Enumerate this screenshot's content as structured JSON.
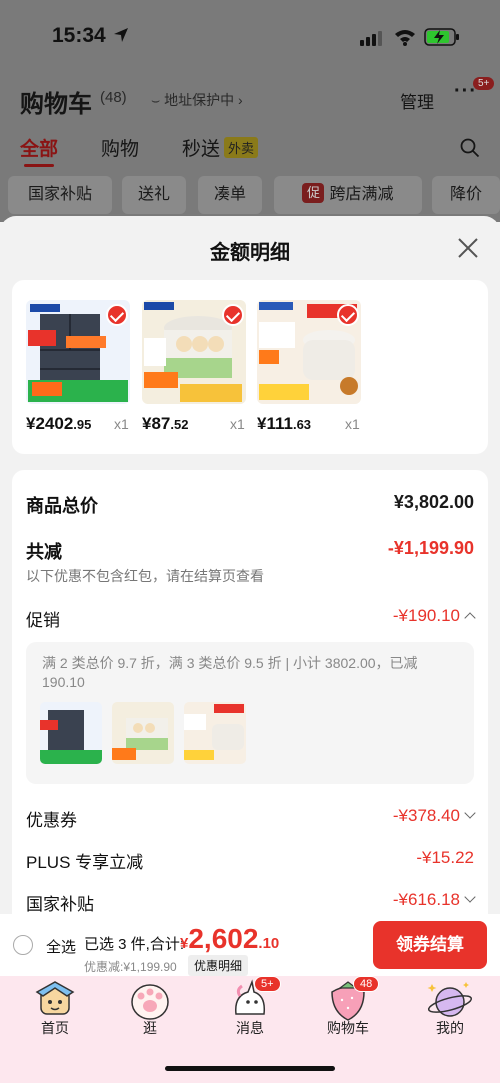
{
  "status_bar": {
    "time": "15:34"
  },
  "background": {
    "title": "购物车",
    "count": "(48)",
    "address": "地址保护中",
    "manage": "管理",
    "more_badge": "5+",
    "tabs": [
      {
        "label": "全部"
      },
      {
        "label": "购物"
      },
      {
        "label": "秒送",
        "tag": "外卖"
      }
    ],
    "chips": [
      "国家补贴",
      "送礼",
      "凑单",
      "跨店满减",
      "降价"
    ],
    "chip_cu": "促"
  },
  "sheet": {
    "title": "金额明细",
    "products": [
      {
        "price_int": "¥2402",
        "price_dec": ".95",
        "qty": "x1"
      },
      {
        "price_int": "¥87",
        "price_dec": ".52",
        "qty": "x1"
      },
      {
        "price_int": "¥111",
        "price_dec": ".63",
        "qty": "x1"
      }
    ],
    "total_label": "商品总价",
    "total_value": "¥3,802.00",
    "reduce_label": "共减",
    "reduce_value": "-¥1,199.90",
    "reduce_note": "以下优惠不包含红包，请在结算页查看",
    "promo_label": "促销",
    "promo_value": "-¥190.10",
    "promo_text": "满 2 类总价 9.7 折，满 3 类总价 9.5 折 | 小计 3802.00，已减 190.10",
    "coupon_label": "优惠券",
    "coupon_value": "-¥378.40",
    "plus_label": "PLUS 专享立减",
    "plus_value": "-¥15.22",
    "subsidy_label": "国家补贴",
    "subsidy_value": "-¥616.18"
  },
  "bottom_bar": {
    "select_all": "全选",
    "selected_text": "已选 3 件,合计:",
    "total_currency": "¥",
    "total_int": "2,602",
    "total_dec": ".10",
    "discount_text": "优惠减:¥1,199.90",
    "detail_button": "优惠明细",
    "checkout_button": "领券结算"
  },
  "tab_bar": {
    "items": [
      {
        "label": "首页"
      },
      {
        "label": "逛"
      },
      {
        "label": "消息",
        "badge": "5+"
      },
      {
        "label": "购物车",
        "badge": "48"
      },
      {
        "label": "我的"
      }
    ]
  },
  "colors": {
    "accent": "#e8332b",
    "tabbar_bg": "#fde7ee",
    "overlay": "#7a7a7a"
  }
}
